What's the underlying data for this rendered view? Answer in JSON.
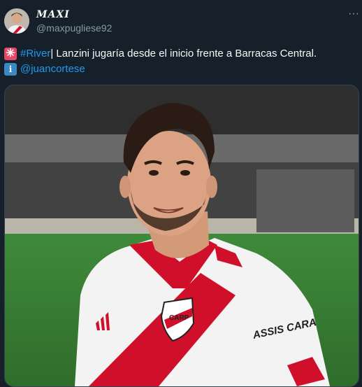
{
  "author": {
    "display_name": "MAXI",
    "handle": "@maxpugliese92"
  },
  "actions": {
    "more_label": "···"
  },
  "tweet": {
    "hashtag": "#River",
    "text": " | Lanzini jugaría desde el inicio frente a Barracas Central.",
    "mention": "@juancortese"
  },
  "media": {
    "jersey_sponsor": "ASSIS CARA"
  },
  "colors": {
    "background": "#15202b",
    "link": "#1d9bf0",
    "secondary_text": "#8b98a5"
  }
}
